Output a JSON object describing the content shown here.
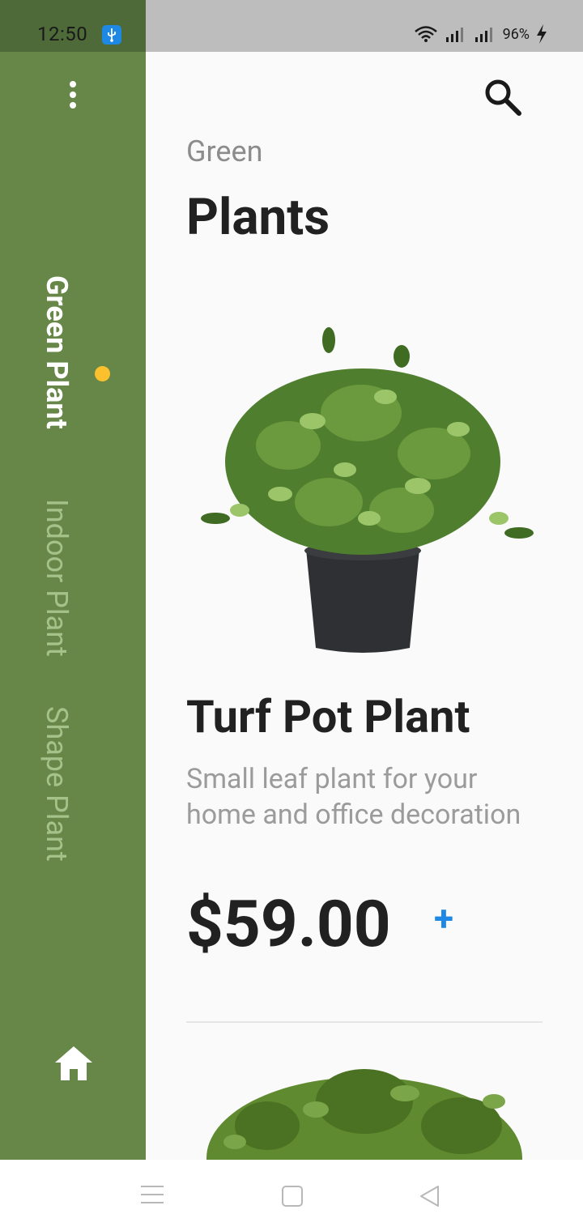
{
  "status_bar": {
    "time": "12:50",
    "battery": "96%"
  },
  "sidebar": {
    "tabs": [
      {
        "label": "Green Plant",
        "active": true
      },
      {
        "label": "Indoor Plant",
        "active": false
      },
      {
        "label": "Shape Plant",
        "active": false
      }
    ],
    "indicator_color": "#fbc02d",
    "background_color": "#678749"
  },
  "header": {
    "subtitle": "Green",
    "title": "Plants"
  },
  "product": {
    "name": "Turf Pot Plant",
    "description": "Small leaf plant for your home and office decoration",
    "price": "$59.00",
    "add_label": "+"
  },
  "colors": {
    "accent": "#1e88e5",
    "indicator": "#fbc02d"
  },
  "icons": {
    "menu": "more-vert-icon",
    "search": "search-icon",
    "home": "home-icon"
  }
}
